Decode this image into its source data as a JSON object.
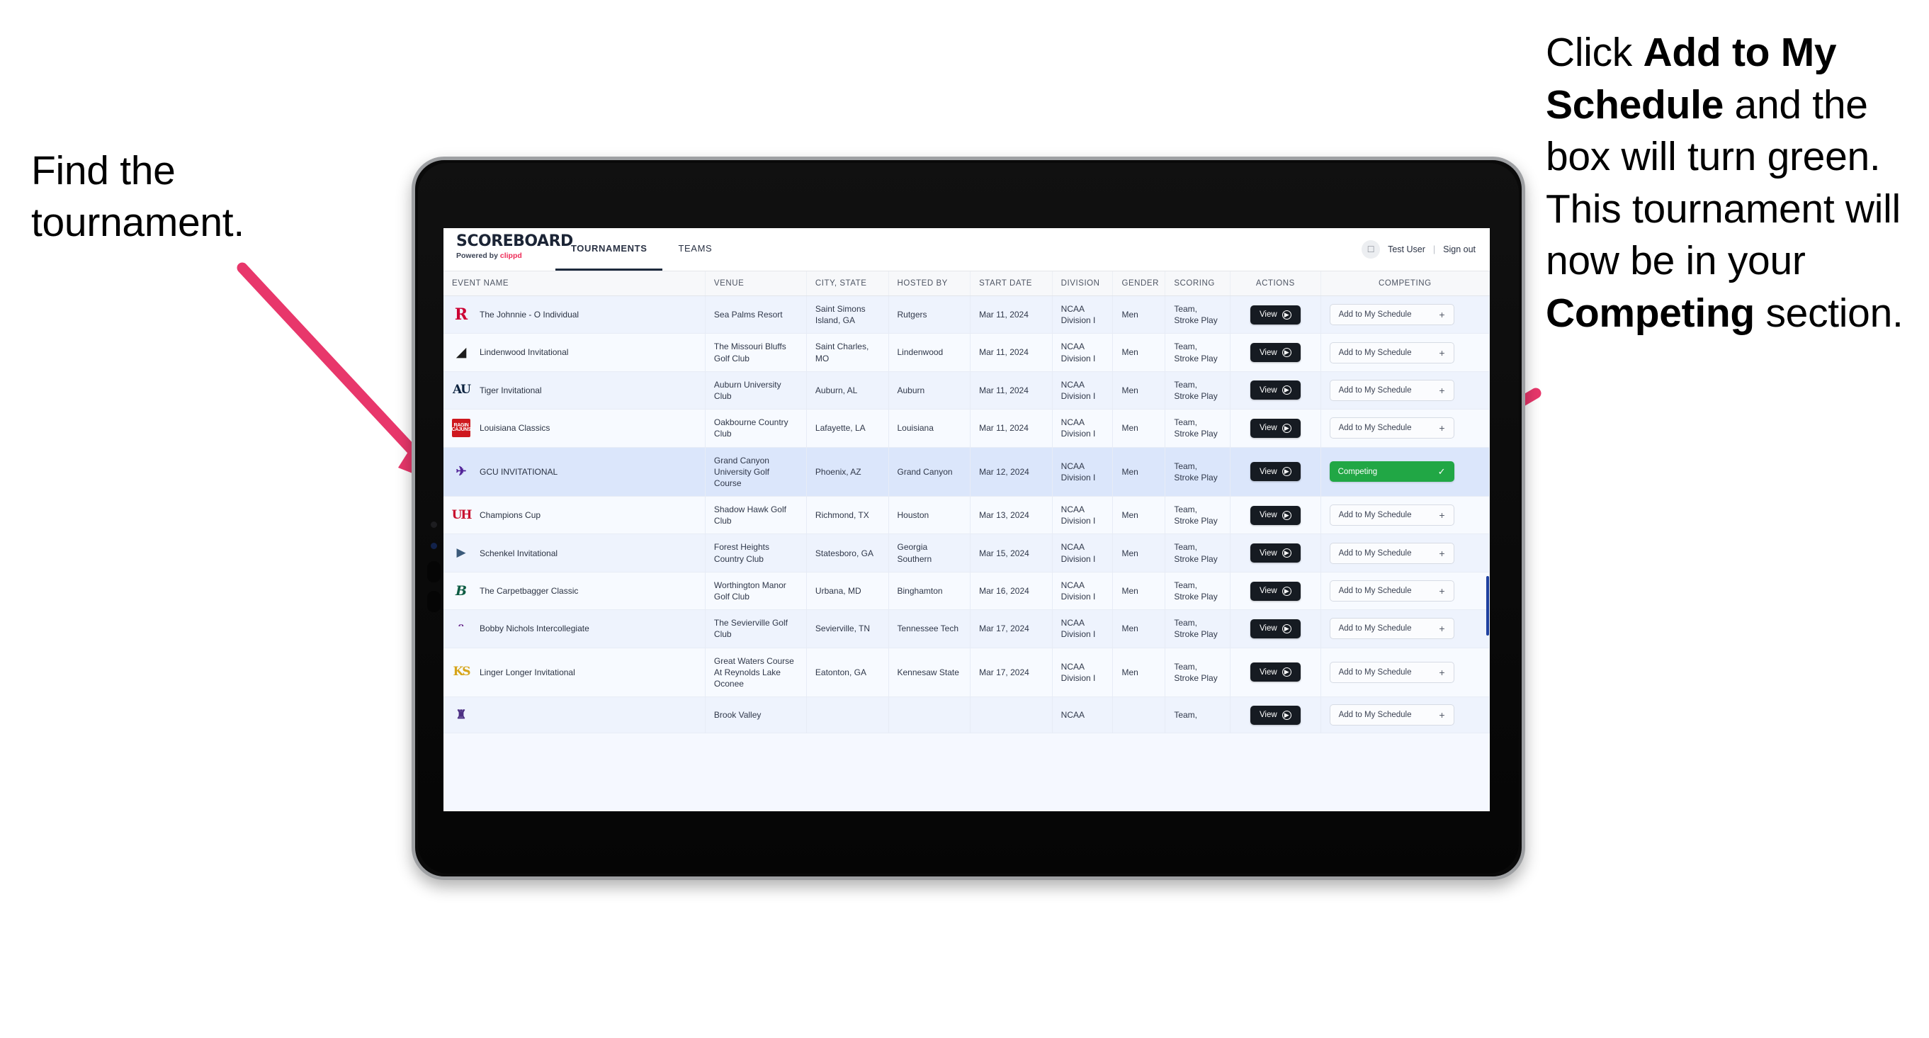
{
  "annotations": {
    "left": {
      "line1": "Find the",
      "line2": "tournament."
    },
    "right": {
      "pre": "Click ",
      "bold1": "Add to My Schedule",
      "mid": " and the box will turn green. This tournament will now be in your ",
      "bold2": "Competing",
      "post": " section."
    }
  },
  "colors": {
    "arrow": "#e8376b",
    "competing_green": "#21a745",
    "brand_accent": "#ee2b57",
    "view_dark": "#161b22",
    "selected_row": "#dbe6fb"
  },
  "app": {
    "brand": {
      "name": "SCOREBOARD",
      "powered_prefix": "Powered by ",
      "powered_brand": "clippd"
    },
    "tabs": [
      {
        "label": "TOURNAMENTS",
        "active": true
      },
      {
        "label": "TEAMS",
        "active": false
      }
    ],
    "account": {
      "avatar_icon": "user-avatar-icon",
      "user": "Test User",
      "separator": "|",
      "sign_out": "Sign out"
    }
  },
  "table": {
    "columns": [
      "EVENT NAME",
      "VENUE",
      "CITY, STATE",
      "HOSTED BY",
      "START DATE",
      "DIVISION",
      "GENDER",
      "SCORING",
      "ACTIONS",
      "COMPETING"
    ],
    "view_label": "View",
    "add_label": "Add to My Schedule",
    "add_plus": "+",
    "competing_label": "Competing",
    "competing_check": "✓",
    "rows": [
      {
        "logo": "rutgers",
        "logo_text": "R",
        "event": "The Johnnie - O Individual",
        "venue": "Sea Palms Resort",
        "city": "Saint Simons Island, GA",
        "hosted_by": "Rutgers",
        "start_date": "Mar 11, 2024",
        "division": "NCAA Division I",
        "gender": "Men",
        "scoring": "Team, Stroke Play",
        "competing": false
      },
      {
        "logo": "lindenwood",
        "logo_text": "◢",
        "event": "Lindenwood Invitational",
        "venue": "The Missouri Bluffs Golf Club",
        "city": "Saint Charles, MO",
        "hosted_by": "Lindenwood",
        "start_date": "Mar 11, 2024",
        "division": "NCAA Division I",
        "gender": "Men",
        "scoring": "Team, Stroke Play",
        "competing": false
      },
      {
        "logo": "auburn",
        "logo_text": "AU",
        "event": "Tiger Invitational",
        "venue": "Auburn University Club",
        "city": "Auburn, AL",
        "hosted_by": "Auburn",
        "start_date": "Mar 11, 2024",
        "division": "NCAA Division I",
        "gender": "Men",
        "scoring": "Team, Stroke Play",
        "competing": false
      },
      {
        "logo": "louisiana",
        "logo_text": "RAGIN CAJUNS",
        "event": "Louisiana Classics",
        "venue": "Oakbourne Country Club",
        "city": "Lafayette, LA",
        "hosted_by": "Louisiana",
        "start_date": "Mar 11, 2024",
        "division": "NCAA Division I",
        "gender": "Men",
        "scoring": "Team, Stroke Play",
        "competing": false
      },
      {
        "logo": "gcu",
        "logo_text": "✈",
        "event": "GCU INVITATIONAL",
        "venue": "Grand Canyon University Golf Course",
        "city": "Phoenix, AZ",
        "hosted_by": "Grand Canyon",
        "start_date": "Mar 12, 2024",
        "division": "NCAA Division I",
        "gender": "Men",
        "scoring": "Team, Stroke Play",
        "competing": true
      },
      {
        "logo": "houston",
        "logo_text": "UH",
        "event": "Champions Cup",
        "venue": "Shadow Hawk Golf Club",
        "city": "Richmond, TX",
        "hosted_by": "Houston",
        "start_date": "Mar 13, 2024",
        "division": "NCAA Division I",
        "gender": "Men",
        "scoring": "Team, Stroke Play",
        "competing": false
      },
      {
        "logo": "gsouthern",
        "logo_text": "▶",
        "event": "Schenkel Invitational",
        "venue": "Forest Heights Country Club",
        "city": "Statesboro, GA",
        "hosted_by": "Georgia Southern",
        "start_date": "Mar 15, 2024",
        "division": "NCAA Division I",
        "gender": "Men",
        "scoring": "Team, Stroke Play",
        "competing": false
      },
      {
        "logo": "binghamton",
        "logo_text": "B",
        "event": "The Carpetbagger Classic",
        "venue": "Worthington Manor Golf Club",
        "city": "Urbana, MD",
        "hosted_by": "Binghamton",
        "start_date": "Mar 16, 2024",
        "division": "NCAA Division I",
        "gender": "Men",
        "scoring": "Team, Stroke Play",
        "competing": false
      },
      {
        "logo": "tntech",
        "logo_text": "ᵔ",
        "event": "Bobby Nichols Intercollegiate",
        "venue": "The Sevierville Golf Club",
        "city": "Sevierville, TN",
        "hosted_by": "Tennessee Tech",
        "start_date": "Mar 17, 2024",
        "division": "NCAA Division I",
        "gender": "Men",
        "scoring": "Team, Stroke Play",
        "competing": false
      },
      {
        "logo": "kennesaw",
        "logo_text": "KS",
        "event": "Linger Longer Invitational",
        "venue": "Great Waters Course At Reynolds Lake Oconee",
        "city": "Eatonton, GA",
        "hosted_by": "Kennesaw State",
        "start_date": "Mar 17, 2024",
        "division": "NCAA Division I",
        "gender": "Men",
        "scoring": "Team, Stroke Play",
        "competing": false
      },
      {
        "logo": "ecarolina",
        "logo_text": "♜",
        "event": "",
        "venue": "Brook Valley",
        "city": "",
        "hosted_by": "",
        "start_date": "",
        "division": "NCAA",
        "gender": "",
        "scoring": "Team,",
        "competing": false
      }
    ]
  }
}
